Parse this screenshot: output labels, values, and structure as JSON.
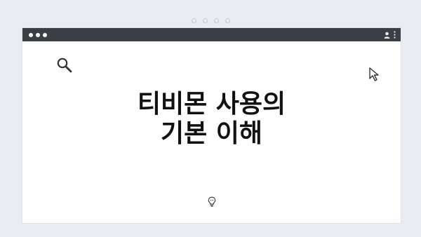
{
  "page": {
    "headline_line1": "티비몬 사용의",
    "headline_line2": "기본 이해"
  },
  "icons": {
    "search": "search-icon",
    "cursor": "cursor-icon",
    "bulb": "lightbulb-icon",
    "user": "user-icon",
    "menu": "kebab-menu-icon"
  },
  "colors": {
    "background": "#e9edf2",
    "titlebar": "#3a3f46",
    "window": "#ffffff",
    "text": "#111111"
  }
}
